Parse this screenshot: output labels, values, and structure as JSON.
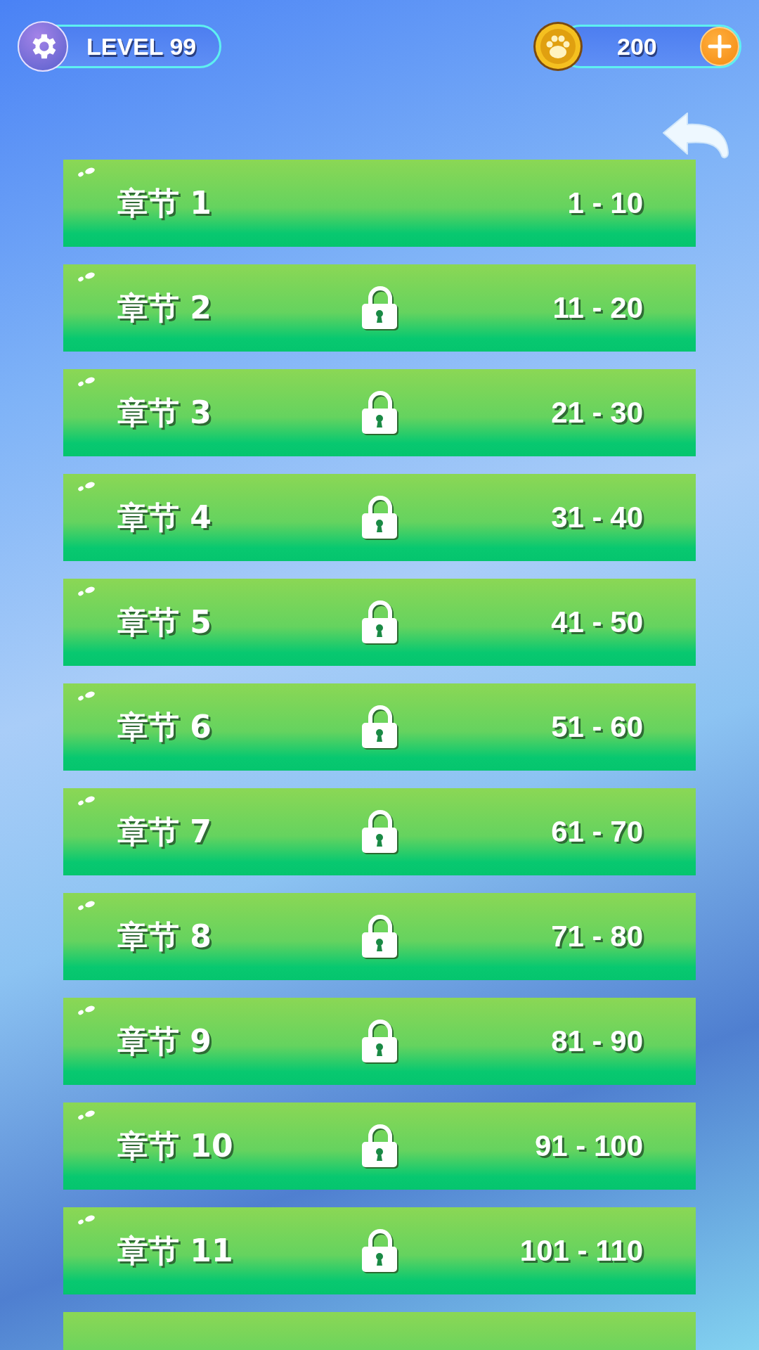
{
  "level_badge": {
    "label": "LEVEL 99"
  },
  "coins": {
    "amount": "200"
  },
  "chapters": [
    {
      "title": "章节 1",
      "range": "1 - 10",
      "locked": false
    },
    {
      "title": "章节 2",
      "range": "11 - 20",
      "locked": true
    },
    {
      "title": "章节 3",
      "range": "21 - 30",
      "locked": true
    },
    {
      "title": "章节 4",
      "range": "31 - 40",
      "locked": true
    },
    {
      "title": "章节 5",
      "range": "41 - 50",
      "locked": true
    },
    {
      "title": "章节 6",
      "range": "51 - 60",
      "locked": true
    },
    {
      "title": "章节 7",
      "range": "61 - 70",
      "locked": true
    },
    {
      "title": "章节 8",
      "range": "71 - 80",
      "locked": true
    },
    {
      "title": "章节 9",
      "range": "81 - 90",
      "locked": true
    },
    {
      "title": "章节 10",
      "range": "91 - 100",
      "locked": true
    },
    {
      "title": "章节 11",
      "range": "101 - 110",
      "locked": true
    }
  ]
}
